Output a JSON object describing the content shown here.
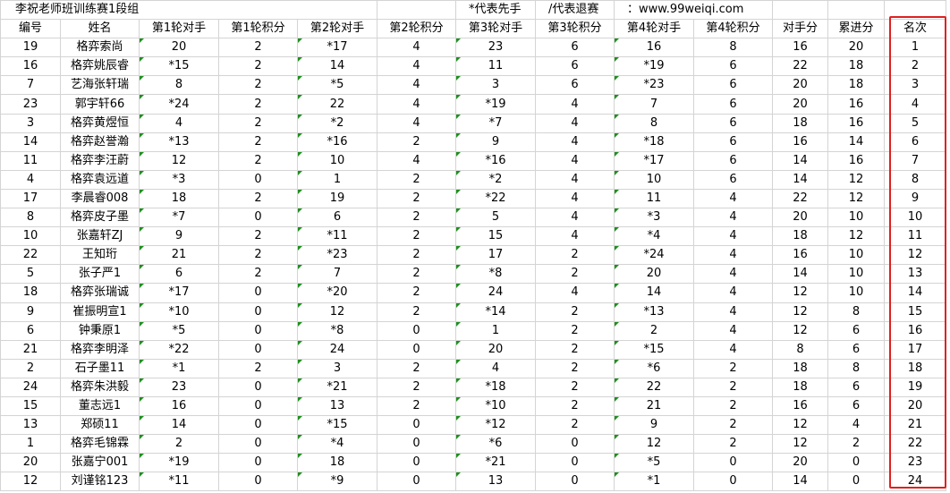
{
  "title": "李祝老师班训练赛1段组",
  "note_first": "*代表先手",
  "note_quit": "/代表退赛",
  "note_site": "：www.99weiqi.com",
  "headers": [
    "编号",
    "姓名",
    "第1轮对手",
    "第1轮积分",
    "第2轮对手",
    "第2轮积分",
    "第3轮对手",
    "第3轮积分",
    "第4轮对手",
    "第4轮积分",
    "对手分",
    "累进分",
    "名次"
  ],
  "rows": [
    [
      "19",
      "格弈索尚",
      "20",
      "2",
      "*17",
      "4",
      "23",
      "6",
      "16",
      "8",
      "16",
      "20",
      "1"
    ],
    [
      "16",
      "格弈姚辰睿",
      "*15",
      "2",
      "14",
      "4",
      "11",
      "6",
      "*19",
      "6",
      "22",
      "18",
      "2"
    ],
    [
      "7",
      "艺海张轩瑞",
      "8",
      "2",
      "*5",
      "4",
      "3",
      "6",
      "*23",
      "6",
      "20",
      "18",
      "3"
    ],
    [
      "23",
      "郭宇轩66",
      "*24",
      "2",
      "22",
      "4",
      "*19",
      "4",
      "7",
      "6",
      "20",
      "16",
      "4"
    ],
    [
      "3",
      "格弈黄煜恒",
      "4",
      "2",
      "*2",
      "4",
      "*7",
      "4",
      "8",
      "6",
      "18",
      "16",
      "5"
    ],
    [
      "14",
      "格弈赵誉瀚",
      "*13",
      "2",
      "*16",
      "2",
      "9",
      "4",
      "*18",
      "6",
      "16",
      "14",
      "6"
    ],
    [
      "11",
      "格弈李汪蔚",
      "12",
      "2",
      "10",
      "4",
      "*16",
      "4",
      "*17",
      "6",
      "14",
      "16",
      "7"
    ],
    [
      "4",
      "格弈袁远道",
      "*3",
      "0",
      "1",
      "2",
      "*2",
      "4",
      "10",
      "6",
      "14",
      "12",
      "8"
    ],
    [
      "17",
      "李晨睿008",
      "18",
      "2",
      "19",
      "2",
      "*22",
      "4",
      "11",
      "4",
      "22",
      "12",
      "9"
    ],
    [
      "8",
      "格弈皮子墨",
      "*7",
      "0",
      "6",
      "2",
      "5",
      "4",
      "*3",
      "4",
      "20",
      "10",
      "10"
    ],
    [
      "10",
      "张嘉轩ZJ",
      "9",
      "2",
      "*11",
      "2",
      "15",
      "4",
      "*4",
      "4",
      "18",
      "12",
      "11"
    ],
    [
      "22",
      "王知珩",
      "21",
      "2",
      "*23",
      "2",
      "17",
      "2",
      "*24",
      "4",
      "16",
      "10",
      "12"
    ],
    [
      "5",
      "张子严1",
      "6",
      "2",
      "7",
      "2",
      "*8",
      "2",
      "20",
      "4",
      "14",
      "10",
      "13"
    ],
    [
      "18",
      "格弈张瑞诚",
      "*17",
      "0",
      "*20",
      "2",
      "24",
      "4",
      "14",
      "4",
      "12",
      "10",
      "14"
    ],
    [
      "9",
      "崔振明宣1",
      "*10",
      "0",
      "12",
      "2",
      "*14",
      "2",
      "*13",
      "4",
      "12",
      "8",
      "15"
    ],
    [
      "6",
      "钟秉原1",
      "*5",
      "0",
      "*8",
      "0",
      "1",
      "2",
      "2",
      "4",
      "12",
      "6",
      "16"
    ],
    [
      "21",
      "格弈李明泽",
      "*22",
      "0",
      "24",
      "0",
      "20",
      "2",
      "*15",
      "4",
      "8",
      "6",
      "17"
    ],
    [
      "2",
      "石子墨11",
      "*1",
      "2",
      "3",
      "2",
      "4",
      "2",
      "*6",
      "2",
      "18",
      "8",
      "18"
    ],
    [
      "24",
      "格弈朱洪毅",
      "23",
      "0",
      "*21",
      "2",
      "*18",
      "2",
      "22",
      "2",
      "18",
      "6",
      "19"
    ],
    [
      "15",
      "董志远1",
      "16",
      "0",
      "13",
      "2",
      "*10",
      "2",
      "21",
      "2",
      "16",
      "6",
      "20"
    ],
    [
      "13",
      "郑硕11",
      "14",
      "0",
      "*15",
      "0",
      "*12",
      "2",
      "9",
      "2",
      "12",
      "4",
      "21"
    ],
    [
      "1",
      "格弈毛锦霖",
      "2",
      "0",
      "*4",
      "0",
      "*6",
      "0",
      "12",
      "2",
      "12",
      "2",
      "22"
    ],
    [
      "20",
      "张嘉宁001",
      "*19",
      "0",
      "18",
      "0",
      "*21",
      "0",
      "*5",
      "0",
      "20",
      "0",
      "23"
    ],
    [
      "12",
      "刘谨铭123",
      "*11",
      "0",
      "*9",
      "0",
      "13",
      "0",
      "*1",
      "0",
      "14",
      "0",
      "24"
    ]
  ],
  "colors": {
    "grid": "#d4d4d4",
    "highlight_border": "#e02020",
    "comment_marker": "#1f8f1f"
  }
}
